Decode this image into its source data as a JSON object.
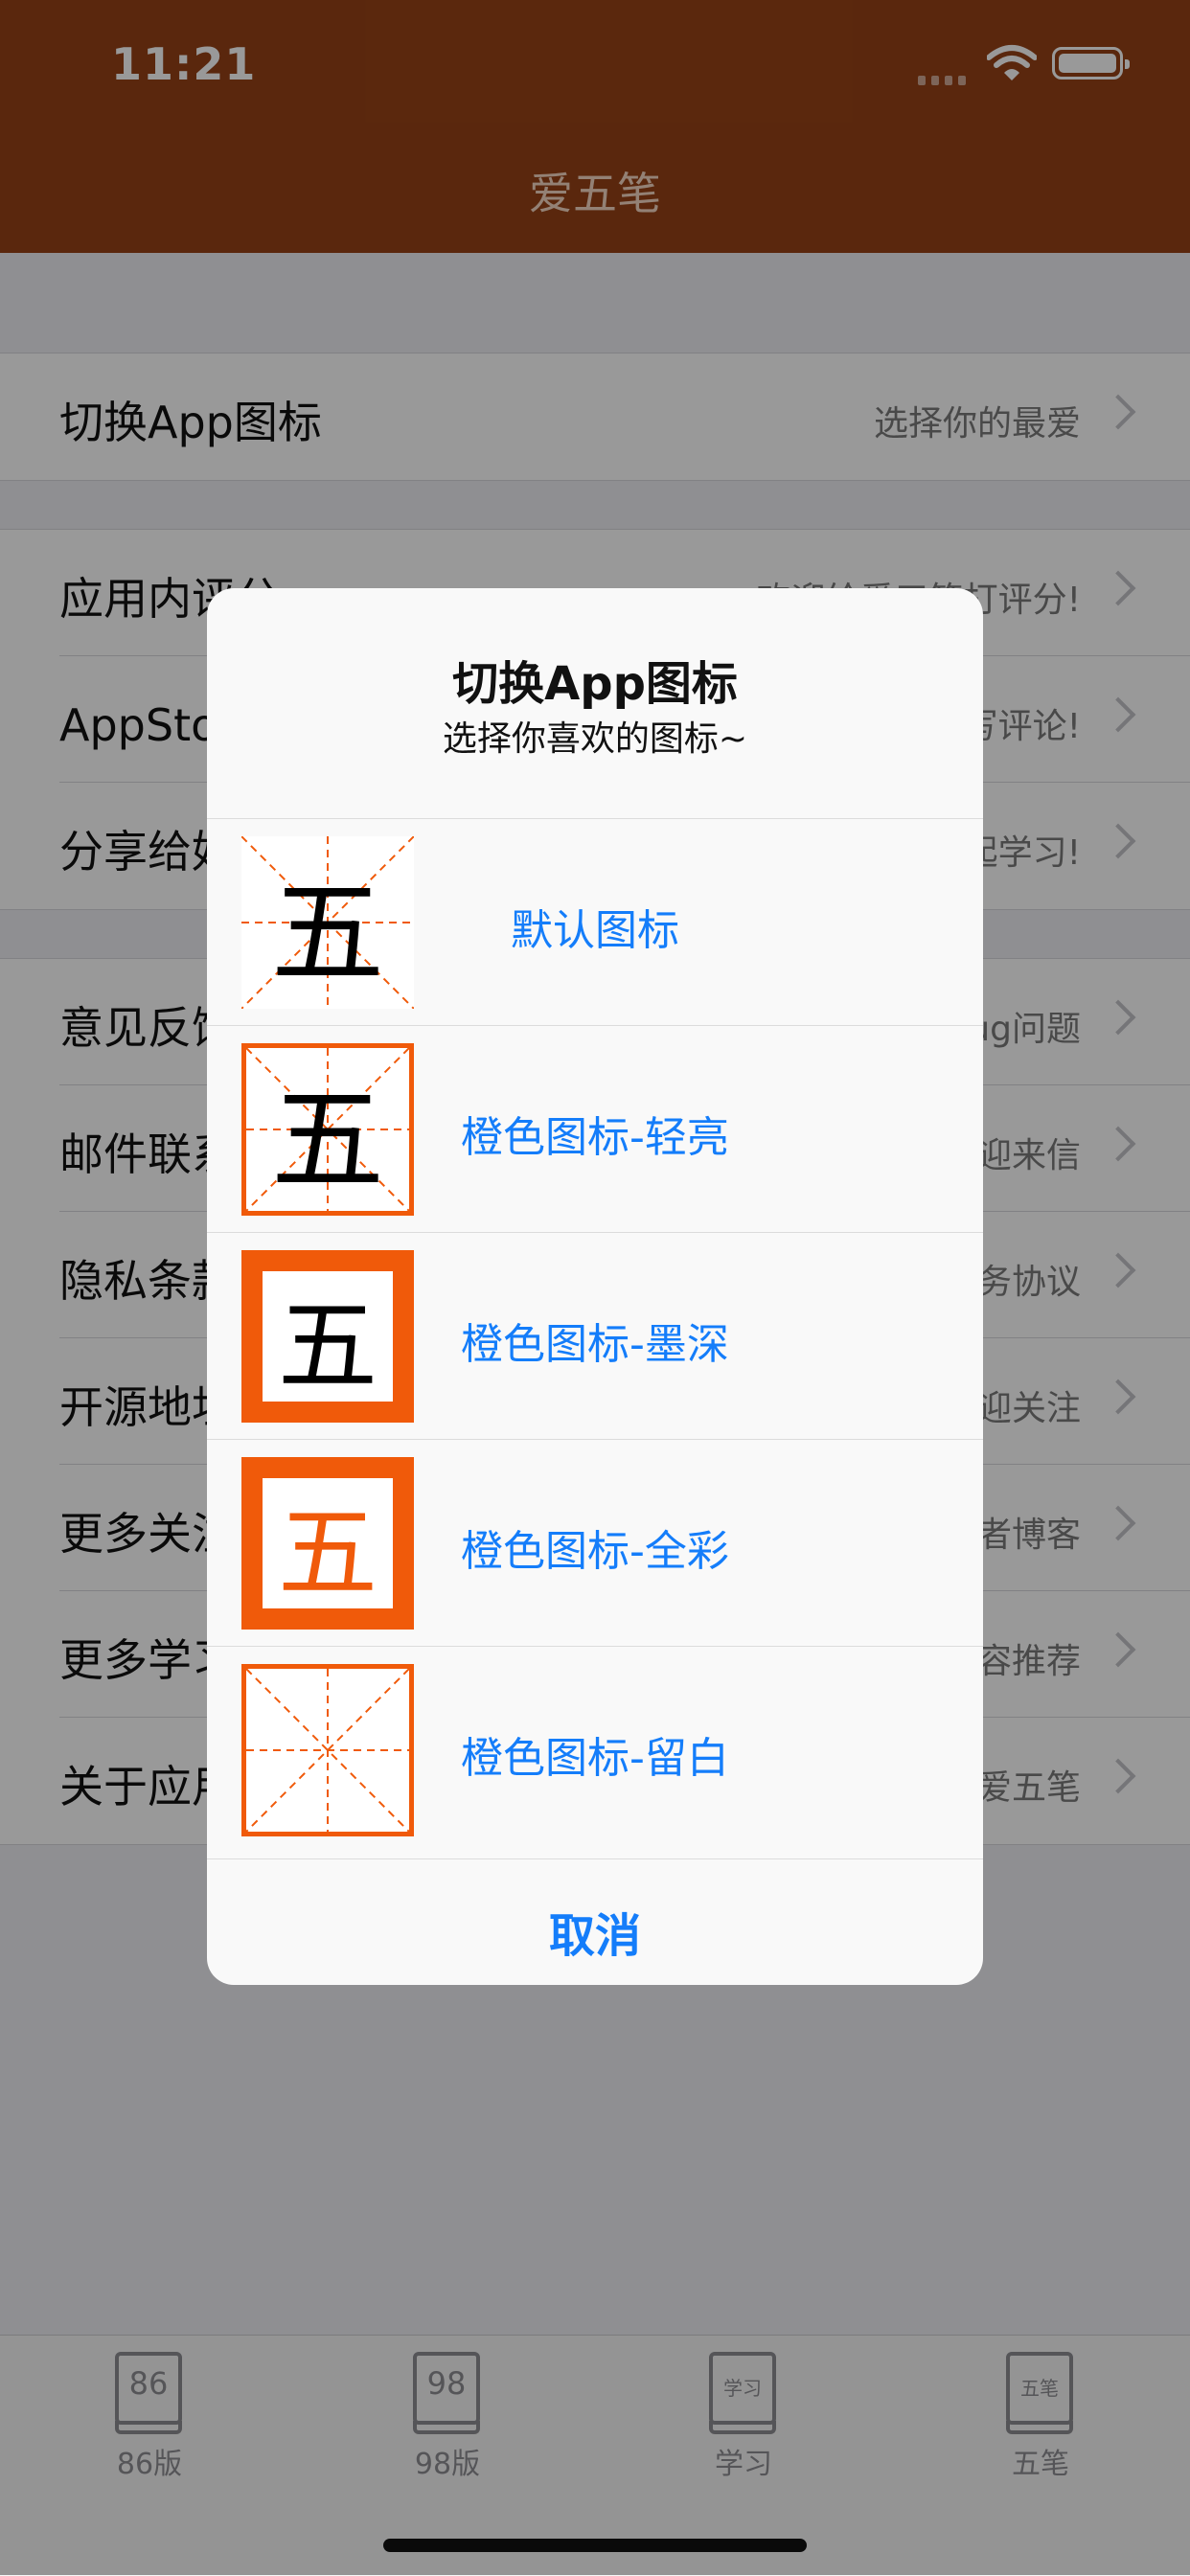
{
  "status_bar": {
    "time": "11:21"
  },
  "nav": {
    "title": "爱五笔"
  },
  "settings": {
    "group1": [
      {
        "title": "切换App图标",
        "detail": "选择你的最爱"
      }
    ],
    "group2": [
      {
        "title": "应用内评分",
        "detail": "欢迎给爱五笔打评分!"
      },
      {
        "title": "AppStore评论",
        "detail": "欢迎给爱五笔写评论!"
      },
      {
        "title": "分享给好友",
        "detail": "一起学习!"
      }
    ],
    "group3": [
      {
        "title": "意见反馈",
        "detail": "Bug问题"
      },
      {
        "title": "邮件联系",
        "detail": "欢迎来信"
      },
      {
        "title": "隐私条款",
        "detail": "服务协议"
      },
      {
        "title": "开源地址",
        "detail": "欢迎关注"
      },
      {
        "title": "更多关注",
        "detail": "作者博客"
      },
      {
        "title": "更多学习",
        "detail": "内容推荐"
      },
      {
        "title": "关于应用",
        "detail": "爱五笔"
      }
    ]
  },
  "tabbar": {
    "tabs": [
      {
        "icon_text": "86",
        "label": "86版"
      },
      {
        "icon_text": "98",
        "label": "98版"
      },
      {
        "icon_text": "学习",
        "label": "学习"
      },
      {
        "icon_text": "五笔",
        "label": "五笔"
      }
    ]
  },
  "dialog": {
    "title": "切换App图标",
    "message": "选择你喜欢的图标~",
    "options": [
      {
        "label": "默认图标",
        "icon_char": "五",
        "icon_style": "default"
      },
      {
        "label": "橙色图标-轻亮",
        "icon_char": "五",
        "icon_style": "light"
      },
      {
        "label": "橙色图标-墨深",
        "icon_char": "五",
        "icon_style": "dark"
      },
      {
        "label": "橙色图标-全彩",
        "icon_char": "五",
        "icon_style": "full"
      },
      {
        "label": "橙色图标-留白",
        "icon_char": "",
        "icon_style": "blank"
      }
    ],
    "cancel": "取消"
  },
  "colors": {
    "nav_background": "#974216",
    "accent_orange": "#f05a0a",
    "action_blue": "#147dfa"
  }
}
